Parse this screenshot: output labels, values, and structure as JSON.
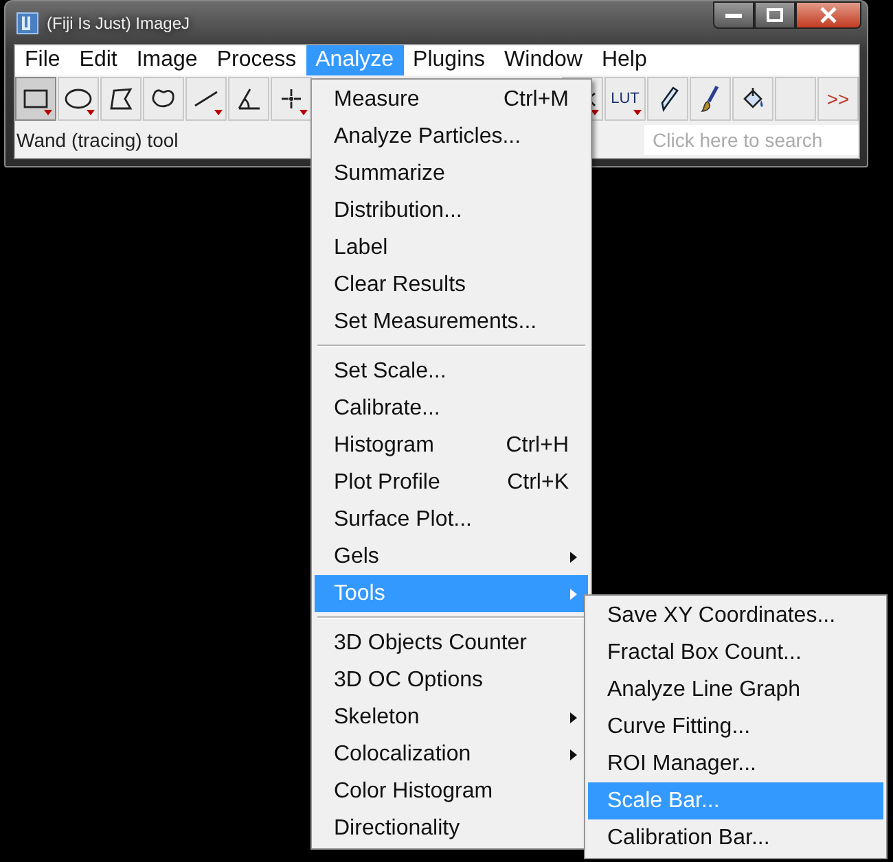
{
  "window": {
    "title": "(Fiji Is Just) ImageJ"
  },
  "menu_bar": [
    {
      "label": "File",
      "selected": false
    },
    {
      "label": "Edit",
      "selected": false
    },
    {
      "label": "Image",
      "selected": false
    },
    {
      "label": "Process",
      "selected": false
    },
    {
      "label": "Analyze",
      "selected": true
    },
    {
      "label": "Plugins",
      "selected": false
    },
    {
      "label": "Window",
      "selected": false
    },
    {
      "label": "Help",
      "selected": false
    }
  ],
  "toolbar_left": [
    {
      "kind": "rectangle",
      "selected": true,
      "has_menu": true
    },
    {
      "kind": "oval",
      "selected": false,
      "has_menu": true
    },
    {
      "kind": "polygon",
      "selected": false,
      "has_menu": false
    },
    {
      "kind": "freehand",
      "selected": false,
      "has_menu": false
    },
    {
      "kind": "line",
      "selected": false,
      "has_menu": true
    },
    {
      "kind": "angle",
      "selected": false,
      "has_menu": false
    },
    {
      "kind": "point",
      "selected": false,
      "has_menu": true
    }
  ],
  "toolbar_right": [
    {
      "kind": "partial",
      "selected": false,
      "has_menu": true
    },
    {
      "kind": "lut",
      "label": "LUT",
      "selected": false,
      "has_menu": true
    },
    {
      "kind": "pencil",
      "selected": false,
      "has_menu": false
    },
    {
      "kind": "brush",
      "selected": false,
      "has_menu": false
    },
    {
      "kind": "fill",
      "selected": false,
      "has_menu": false
    },
    {
      "kind": "blank",
      "selected": false,
      "has_menu": false
    },
    {
      "kind": "more",
      "label": ">>",
      "selected": false,
      "has_menu": false
    }
  ],
  "status": "Wand (tracing) tool",
  "search": {
    "placeholder": "Click here to search"
  },
  "analyze_menu": [
    {
      "kind": "item",
      "label": "Measure",
      "shortcut": "Ctrl+M",
      "submenu": false,
      "selected": false
    },
    {
      "kind": "item",
      "label": "Analyze Particles...",
      "submenu": false,
      "selected": false
    },
    {
      "kind": "item",
      "label": "Summarize",
      "submenu": false,
      "selected": false
    },
    {
      "kind": "item",
      "label": "Distribution...",
      "submenu": false,
      "selected": false
    },
    {
      "kind": "item",
      "label": "Label",
      "submenu": false,
      "selected": false
    },
    {
      "kind": "item",
      "label": "Clear Results",
      "submenu": false,
      "selected": false
    },
    {
      "kind": "item",
      "label": "Set Measurements...",
      "submenu": false,
      "selected": false
    },
    {
      "kind": "separator"
    },
    {
      "kind": "item",
      "label": "Set Scale...",
      "submenu": false,
      "selected": false
    },
    {
      "kind": "item",
      "label": "Calibrate...",
      "submenu": false,
      "selected": false
    },
    {
      "kind": "item",
      "label": "Histogram",
      "shortcut": "Ctrl+H",
      "submenu": false,
      "selected": false
    },
    {
      "kind": "item",
      "label": "Plot Profile",
      "shortcut": "Ctrl+K",
      "submenu": false,
      "selected": false
    },
    {
      "kind": "item",
      "label": "Surface Plot...",
      "submenu": false,
      "selected": false
    },
    {
      "kind": "item",
      "label": "Gels",
      "submenu": true,
      "selected": false
    },
    {
      "kind": "item",
      "label": "Tools",
      "submenu": true,
      "selected": true
    },
    {
      "kind": "separator"
    },
    {
      "kind": "item",
      "label": "3D Objects Counter",
      "submenu": false,
      "selected": false
    },
    {
      "kind": "item",
      "label": "3D OC Options",
      "submenu": false,
      "selected": false
    },
    {
      "kind": "item",
      "label": "Skeleton",
      "submenu": true,
      "selected": false
    },
    {
      "kind": "item",
      "label": "Colocalization",
      "submenu": true,
      "selected": false
    },
    {
      "kind": "item",
      "label": "Color Histogram",
      "submenu": false,
      "selected": false
    },
    {
      "kind": "item",
      "label": "Directionality",
      "submenu": false,
      "selected": false
    }
  ],
  "tools_submenu": [
    {
      "kind": "item",
      "label": "Save XY Coordinates...",
      "submenu": false,
      "selected": false
    },
    {
      "kind": "item",
      "label": "Fractal Box Count...",
      "submenu": false,
      "selected": false
    },
    {
      "kind": "item",
      "label": "Analyze Line Graph",
      "submenu": false,
      "selected": false
    },
    {
      "kind": "item",
      "label": "Curve Fitting...",
      "submenu": false,
      "selected": false
    },
    {
      "kind": "item",
      "label": "ROI Manager...",
      "submenu": false,
      "selected": false
    },
    {
      "kind": "item",
      "label": "Scale Bar...",
      "submenu": false,
      "selected": true
    },
    {
      "kind": "item",
      "label": "Calibration Bar...",
      "submenu": false,
      "selected": false
    }
  ]
}
